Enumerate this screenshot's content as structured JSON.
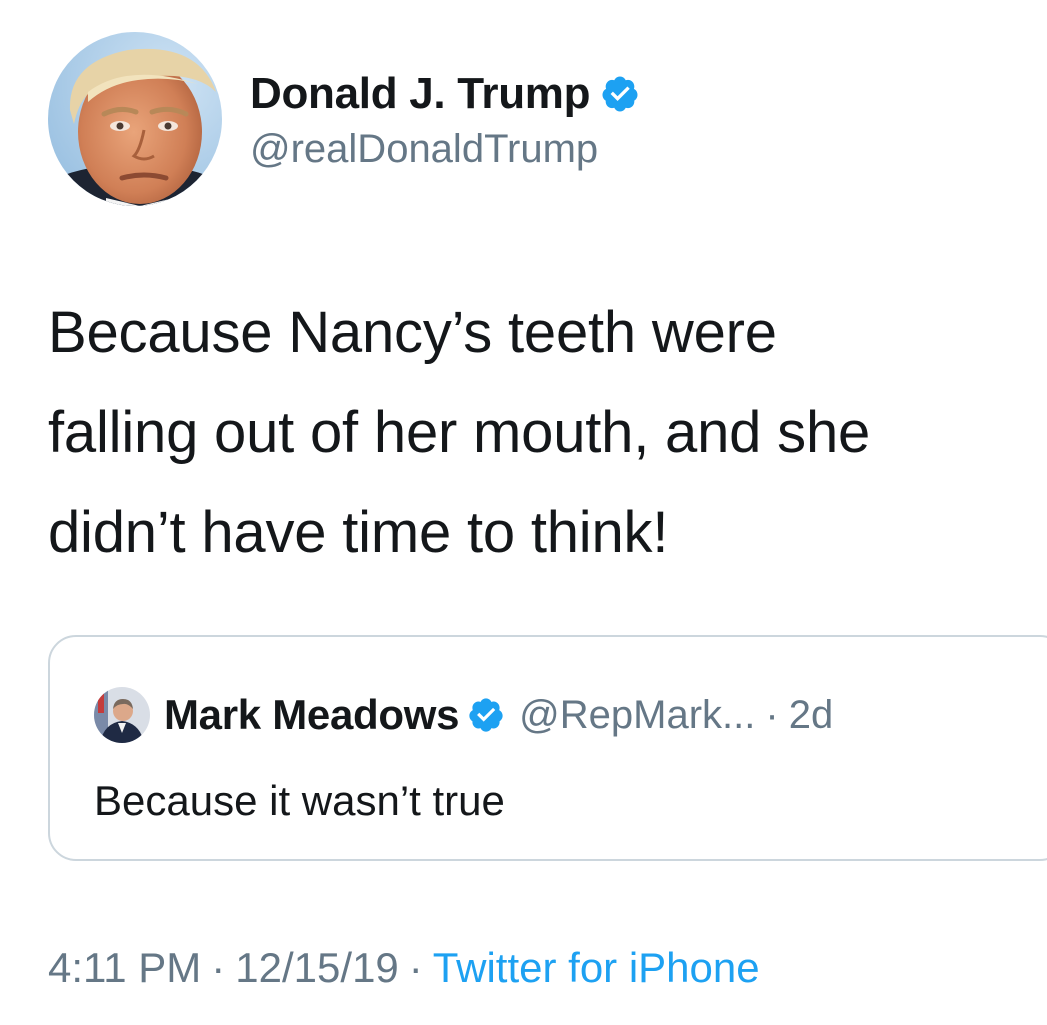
{
  "author": {
    "display_name": "Donald J. Trump",
    "handle": "@realDonaldTrump",
    "verified_icon": "verified-badge-icon",
    "avatar_icon": "profile-photo-avatar"
  },
  "tweet": {
    "text_lines": [
      "Because Nancy’s teeth were",
      "falling out of her mouth, and she",
      "didn’t have time to think!"
    ]
  },
  "quoted_tweet": {
    "display_name": "Mark Meadows",
    "handle": "@RepMark...",
    "separator": "·",
    "time": "2d",
    "text": "Because it wasn’t true",
    "verified_icon": "verified-badge-icon",
    "avatar_icon": "profile-photo-avatar"
  },
  "meta": {
    "time": "4:11 PM",
    "date": "12/15/19",
    "separator": "·",
    "source": "Twitter for iPhone"
  },
  "colors": {
    "text_primary": "#14171a",
    "text_secondary": "#657786",
    "accent_blue": "#1da1f2",
    "border": "#ccd6dd"
  }
}
